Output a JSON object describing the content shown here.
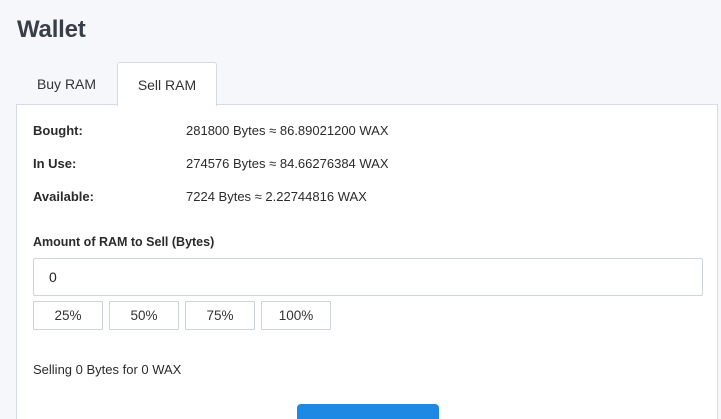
{
  "page": {
    "title": "Wallet"
  },
  "tabs": [
    {
      "label": "Buy RAM",
      "active": false
    },
    {
      "label": "Sell RAM",
      "active": true
    }
  ],
  "ram_info": {
    "bought": {
      "label": "Bought:",
      "value": "281800 Bytes ≈ 86.89021200 WAX"
    },
    "in_use": {
      "label": "In Use:",
      "value": "274576 Bytes ≈ 84.66276384 WAX"
    },
    "available": {
      "label": "Available:",
      "value": "7224 Bytes ≈ 2.22744816 WAX"
    }
  },
  "sell_form": {
    "amount_label": "Amount of RAM to Sell (Bytes)",
    "amount_value": "0",
    "percent_buttons": [
      "25%",
      "50%",
      "75%",
      "100%"
    ],
    "summary": "Selling 0 Bytes for 0 WAX"
  },
  "colors": {
    "accent": "#1e88e5",
    "border": "#d6dbe1",
    "background": "#f5f7fa"
  }
}
